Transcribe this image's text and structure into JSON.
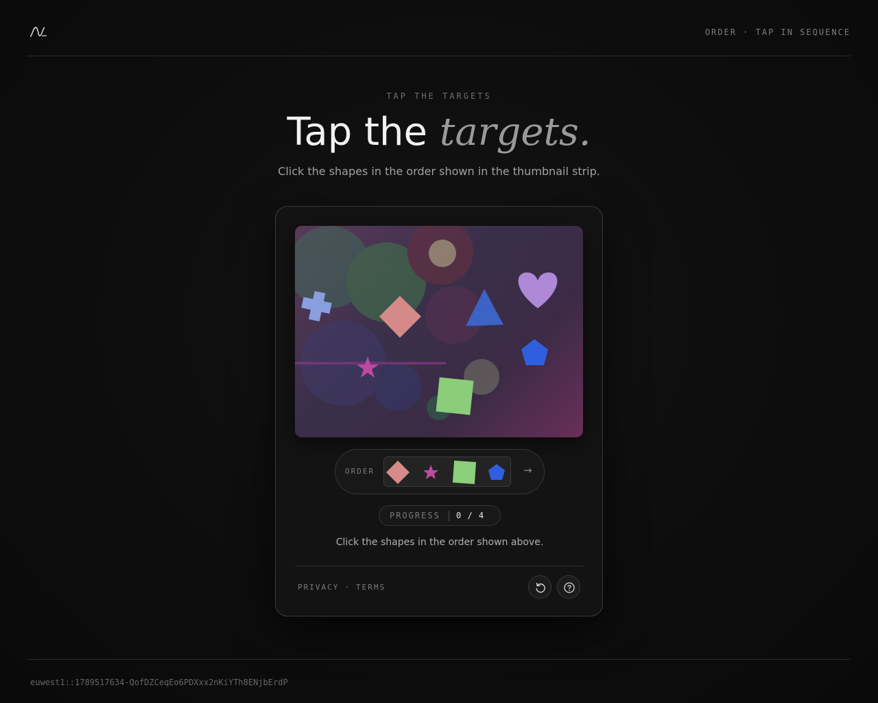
{
  "header": {
    "logo": "wave-logo-icon",
    "tag": "ORDER · TAP IN SEQUENCE"
  },
  "hero": {
    "eyebrow": "TAP THE TARGETS",
    "title_plain": "Tap the",
    "title_emphasis": "targets.",
    "subtitle": "Click the shapes in the order shown in the thumbnail strip."
  },
  "challenge": {
    "canvas_shapes": [
      {
        "name": "heart-shape",
        "color": "#b08ad8"
      },
      {
        "name": "triangle-shape",
        "color": "#3d63c8"
      },
      {
        "name": "pentagon-shape",
        "color": "#2f5fe0"
      },
      {
        "name": "diamond-shape",
        "color": "#d88a8a"
      },
      {
        "name": "cross-shape",
        "color": "#8aa0e0"
      },
      {
        "name": "star-shape",
        "color": "#c04aa0"
      },
      {
        "name": "square-shape",
        "color": "#8ccf7a"
      }
    ],
    "order_label": "ORDER",
    "order_sequence": [
      {
        "name": "diamond-shape",
        "color": "#d88a8a"
      },
      {
        "name": "star-shape",
        "color": "#c04aa0"
      },
      {
        "name": "square-shape",
        "color": "#8ccf7a"
      },
      {
        "name": "pentagon-shape",
        "color": "#2f5fe0"
      }
    ],
    "order_arrow": "→",
    "progress_label": "PROGRESS",
    "progress_value": "0 / 4",
    "progress_done": 0,
    "progress_total": 4,
    "instructions": "Click the shapes in the order shown above."
  },
  "footer_card": {
    "privacy": "PRIVACY",
    "separator": "·",
    "terms": "TERMS",
    "reload_icon": "reload-icon",
    "help_icon": "help-icon"
  },
  "session": {
    "id": "euwest1::1789517634-QofDZCeqEo6PDXxx2nKiYTh8ENjbErdP"
  }
}
